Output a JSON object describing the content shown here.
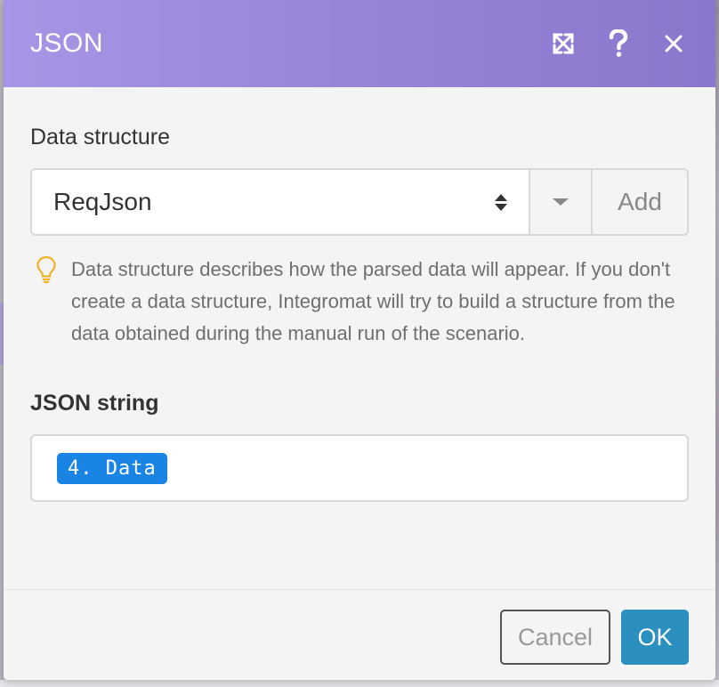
{
  "dialog": {
    "title": "JSON",
    "header_icons": [
      "expand-icon",
      "help-icon",
      "close-icon"
    ]
  },
  "data_structure": {
    "label": "Data structure",
    "selected_value": "ReqJson",
    "add_label": "Add",
    "hint": "Data structure describes how the parsed data will appear. If you don't create a data structure, Integromat will try to build a structure from the data obtained during the manual run of the scenario."
  },
  "json_string": {
    "label": "JSON string",
    "token": "4. Data"
  },
  "footer": {
    "cancel_label": "Cancel",
    "ok_label": "OK"
  },
  "colors": {
    "header_gradient_start": "#a795e6",
    "header_gradient_end": "#8a76cc",
    "token_bg": "#1a84e5",
    "ok_button": "#2b8fbf",
    "hint_icon": "#f0b429"
  }
}
